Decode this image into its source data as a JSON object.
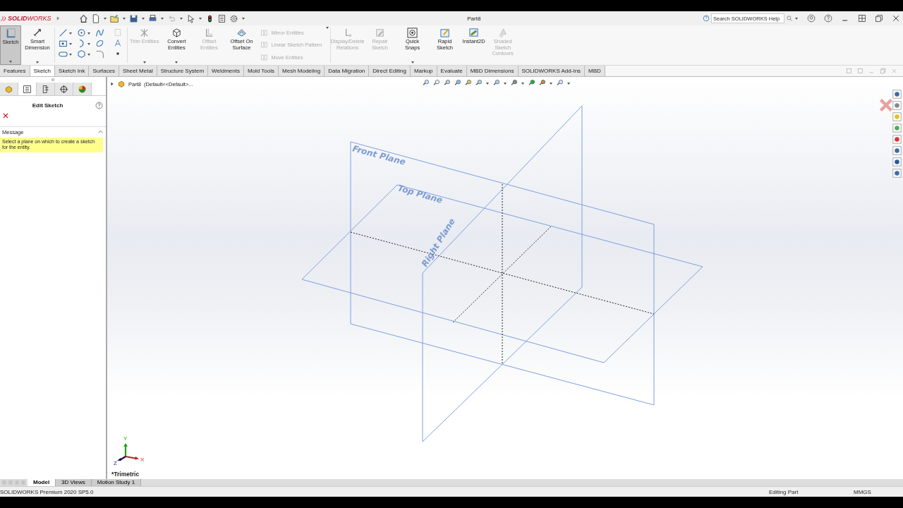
{
  "app": {
    "logo": "**SOLID**WORKS",
    "title": "Part8",
    "search": {
      "placeholder": "Search SOLIDWORKS Help"
    }
  },
  "ribbon": [
    {
      "kind": "large",
      "label": "Sketch",
      "selected": true,
      "disabled": false
    },
    {
      "kind": "large",
      "label": "Smart Dimension",
      "selected": false,
      "disabled": false
    },
    {
      "kind": "grid"
    },
    {
      "kind": "large",
      "label": "Trim Entities",
      "selected": false,
      "disabled": true
    },
    {
      "kind": "large",
      "label": "Convert Entities",
      "selected": false,
      "disabled": false
    },
    {
      "kind": "large",
      "label": "Offset Entities",
      "selected": false,
      "disabled": true
    },
    {
      "kind": "large",
      "label": "Offset On Surface",
      "selected": false,
      "disabled": false
    },
    {
      "kind": "list",
      "items": [
        {
          "label": "Mirror Entities",
          "disabled": true
        },
        {
          "label": "Linear Sketch Pattern",
          "disabled": true
        },
        {
          "label": "Move Entities",
          "disabled": true
        }
      ]
    },
    {
      "kind": "large",
      "label": "Display/Delete Relations",
      "selected": false,
      "disabled": true
    },
    {
      "kind": "large",
      "label": "Repair Sketch",
      "selected": false,
      "disabled": true
    },
    {
      "kind": "large",
      "label": "Quick Snaps",
      "selected": false,
      "disabled": false
    },
    {
      "kind": "large",
      "label": "Rapid Sketch",
      "selected": false,
      "disabled": false
    },
    {
      "kind": "large",
      "label": "Instant2D",
      "selected": false,
      "disabled": false
    },
    {
      "kind": "large",
      "label": "Shaded Sketch Contours",
      "selected": false,
      "disabled": true
    }
  ],
  "command_tabs": [
    {
      "label": "Features",
      "selected": false
    },
    {
      "label": "Sketch",
      "selected": true
    },
    {
      "label": "Sketch Ink",
      "selected": false
    },
    {
      "label": "Surfaces",
      "selected": false
    },
    {
      "label": "Sheet Metal",
      "selected": false
    },
    {
      "label": "Structure System",
      "selected": false
    },
    {
      "label": "Weldments",
      "selected": false
    },
    {
      "label": "Mold Tools",
      "selected": false
    },
    {
      "label": "Mesh Modeling",
      "selected": false
    },
    {
      "label": "Data Migration",
      "selected": false
    },
    {
      "label": "Direct Editing",
      "selected": false
    },
    {
      "label": "Markup",
      "selected": false
    },
    {
      "label": "Evaluate",
      "selected": false
    },
    {
      "label": "MBD Dimensions",
      "selected": false
    },
    {
      "label": "SOLIDWORKS Add-Ins",
      "selected": false
    },
    {
      "label": "MBD",
      "selected": false
    }
  ],
  "property_manager": {
    "panel_tabs": [
      {
        "selected": false
      },
      {
        "selected": true
      },
      {
        "selected": false
      },
      {
        "selected": false
      },
      {
        "selected": false
      }
    ],
    "title": "Edit Sketch",
    "section": "Message",
    "message": "Select a plane on which to create a sketch for the entity."
  },
  "tree": {
    "item": "Part8  (Default<<Default>..."
  },
  "viewport": {
    "planes": [
      {
        "label": "Front Plane"
      },
      {
        "label": "Top Plane"
      },
      {
        "label": "Right Plane"
      }
    ],
    "axis_labels": [
      "Y",
      "X",
      "Z"
    ],
    "view_name": "*Trimetric"
  },
  "bottom_tabs": [
    {
      "label": "Model",
      "selected": true
    },
    {
      "label": "3D Views",
      "selected": false
    },
    {
      "label": "Motion Study 1",
      "selected": false
    }
  ],
  "status_bar": {
    "product": "SOLIDWORKS Premium 2020 SP5.0",
    "mode": "Editing Part",
    "units": "MMGS"
  }
}
